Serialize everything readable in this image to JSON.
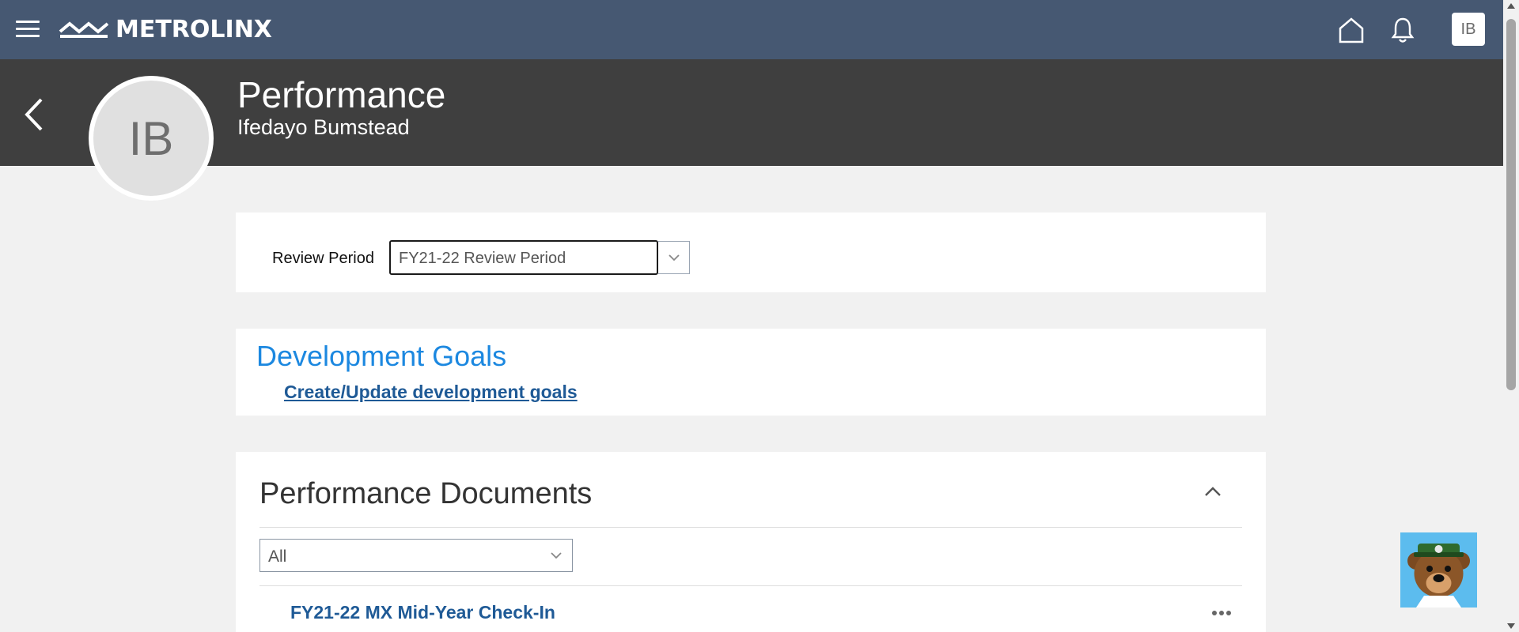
{
  "topbar": {
    "brand": "METROLINX",
    "user_initials": "IB",
    "icons": [
      "menu-icon",
      "metrolinx-logo-icon",
      "home-icon",
      "bell-icon"
    ]
  },
  "header": {
    "title": "Performance",
    "subtitle": "Ifedayo Bumstead",
    "avatar_initials": "IB"
  },
  "review": {
    "label": "Review Period",
    "value": "FY21-22 Review Period"
  },
  "development": {
    "title": "Development Goals",
    "link": "Create/Update development goals"
  },
  "documents": {
    "title": "Performance Documents",
    "filter_value": "All",
    "items": [
      {
        "label": "FY21-22 MX Mid-Year Check-In"
      }
    ]
  },
  "colors": {
    "topbar": "#465872",
    "header": "#3f3f3f",
    "accent_blue": "#1c88e0",
    "link_blue": "#1f5a96"
  }
}
